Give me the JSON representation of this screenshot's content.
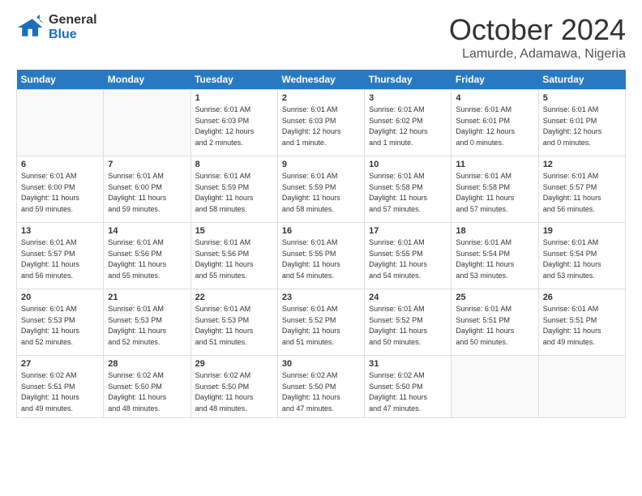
{
  "header": {
    "logo_general": "General",
    "logo_blue": "Blue",
    "month_title": "October 2024",
    "location": "Lamurde, Adamawa, Nigeria"
  },
  "calendar": {
    "days_of_week": [
      "Sunday",
      "Monday",
      "Tuesday",
      "Wednesday",
      "Thursday",
      "Friday",
      "Saturday"
    ],
    "weeks": [
      [
        {
          "day": "",
          "info": ""
        },
        {
          "day": "",
          "info": ""
        },
        {
          "day": "1",
          "info": "Sunrise: 6:01 AM\nSunset: 6:03 PM\nDaylight: 12 hours\nand 2 minutes."
        },
        {
          "day": "2",
          "info": "Sunrise: 6:01 AM\nSunset: 6:03 PM\nDaylight: 12 hours\nand 1 minute."
        },
        {
          "day": "3",
          "info": "Sunrise: 6:01 AM\nSunset: 6:02 PM\nDaylight: 12 hours\nand 1 minute."
        },
        {
          "day": "4",
          "info": "Sunrise: 6:01 AM\nSunset: 6:01 PM\nDaylight: 12 hours\nand 0 minutes."
        },
        {
          "day": "5",
          "info": "Sunrise: 6:01 AM\nSunset: 6:01 PM\nDaylight: 12 hours\nand 0 minutes."
        }
      ],
      [
        {
          "day": "6",
          "info": "Sunrise: 6:01 AM\nSunset: 6:00 PM\nDaylight: 11 hours\nand 59 minutes."
        },
        {
          "day": "7",
          "info": "Sunrise: 6:01 AM\nSunset: 6:00 PM\nDaylight: 11 hours\nand 59 minutes."
        },
        {
          "day": "8",
          "info": "Sunrise: 6:01 AM\nSunset: 5:59 PM\nDaylight: 11 hours\nand 58 minutes."
        },
        {
          "day": "9",
          "info": "Sunrise: 6:01 AM\nSunset: 5:59 PM\nDaylight: 11 hours\nand 58 minutes."
        },
        {
          "day": "10",
          "info": "Sunrise: 6:01 AM\nSunset: 5:58 PM\nDaylight: 11 hours\nand 57 minutes."
        },
        {
          "day": "11",
          "info": "Sunrise: 6:01 AM\nSunset: 5:58 PM\nDaylight: 11 hours\nand 57 minutes."
        },
        {
          "day": "12",
          "info": "Sunrise: 6:01 AM\nSunset: 5:57 PM\nDaylight: 11 hours\nand 56 minutes."
        }
      ],
      [
        {
          "day": "13",
          "info": "Sunrise: 6:01 AM\nSunset: 5:57 PM\nDaylight: 11 hours\nand 56 minutes."
        },
        {
          "day": "14",
          "info": "Sunrise: 6:01 AM\nSunset: 5:56 PM\nDaylight: 11 hours\nand 55 minutes."
        },
        {
          "day": "15",
          "info": "Sunrise: 6:01 AM\nSunset: 5:56 PM\nDaylight: 11 hours\nand 55 minutes."
        },
        {
          "day": "16",
          "info": "Sunrise: 6:01 AM\nSunset: 5:55 PM\nDaylight: 11 hours\nand 54 minutes."
        },
        {
          "day": "17",
          "info": "Sunrise: 6:01 AM\nSunset: 5:55 PM\nDaylight: 11 hours\nand 54 minutes."
        },
        {
          "day": "18",
          "info": "Sunrise: 6:01 AM\nSunset: 5:54 PM\nDaylight: 11 hours\nand 53 minutes."
        },
        {
          "day": "19",
          "info": "Sunrise: 6:01 AM\nSunset: 5:54 PM\nDaylight: 11 hours\nand 53 minutes."
        }
      ],
      [
        {
          "day": "20",
          "info": "Sunrise: 6:01 AM\nSunset: 5:53 PM\nDaylight: 11 hours\nand 52 minutes."
        },
        {
          "day": "21",
          "info": "Sunrise: 6:01 AM\nSunset: 5:53 PM\nDaylight: 11 hours\nand 52 minutes."
        },
        {
          "day": "22",
          "info": "Sunrise: 6:01 AM\nSunset: 5:53 PM\nDaylight: 11 hours\nand 51 minutes."
        },
        {
          "day": "23",
          "info": "Sunrise: 6:01 AM\nSunset: 5:52 PM\nDaylight: 11 hours\nand 51 minutes."
        },
        {
          "day": "24",
          "info": "Sunrise: 6:01 AM\nSunset: 5:52 PM\nDaylight: 11 hours\nand 50 minutes."
        },
        {
          "day": "25",
          "info": "Sunrise: 6:01 AM\nSunset: 5:51 PM\nDaylight: 11 hours\nand 50 minutes."
        },
        {
          "day": "26",
          "info": "Sunrise: 6:01 AM\nSunset: 5:51 PM\nDaylight: 11 hours\nand 49 minutes."
        }
      ],
      [
        {
          "day": "27",
          "info": "Sunrise: 6:02 AM\nSunset: 5:51 PM\nDaylight: 11 hours\nand 49 minutes."
        },
        {
          "day": "28",
          "info": "Sunrise: 6:02 AM\nSunset: 5:50 PM\nDaylight: 11 hours\nand 48 minutes."
        },
        {
          "day": "29",
          "info": "Sunrise: 6:02 AM\nSunset: 5:50 PM\nDaylight: 11 hours\nand 48 minutes."
        },
        {
          "day": "30",
          "info": "Sunrise: 6:02 AM\nSunset: 5:50 PM\nDaylight: 11 hours\nand 47 minutes."
        },
        {
          "day": "31",
          "info": "Sunrise: 6:02 AM\nSunset: 5:50 PM\nDaylight: 11 hours\nand 47 minutes."
        },
        {
          "day": "",
          "info": ""
        },
        {
          "day": "",
          "info": ""
        }
      ]
    ]
  }
}
